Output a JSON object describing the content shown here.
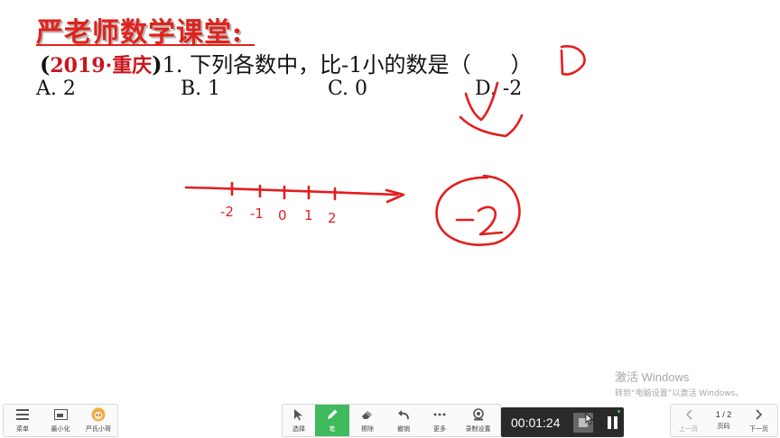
{
  "title": "严老师数学课堂:",
  "question": {
    "paren_open": "(",
    "source": "2019·重庆",
    "paren_close": ")",
    "text": "1. 下列各数中，比-1小的数是（",
    "answer_close": "）"
  },
  "options": [
    "A. 2",
    "B. 1",
    "C. 0",
    "D. -2"
  ],
  "handwriting": {
    "answer_letter": "D",
    "number_line_labels": [
      "-2",
      "-1",
      "0",
      "1",
      "2"
    ],
    "circled_number": "-2"
  },
  "watermark": {
    "title": "激活 Windows",
    "subtitle": "转到“电脑设置”以激活 Windows。"
  },
  "toolbar": {
    "left": [
      {
        "label": "菜单",
        "icon": "menu-icon"
      },
      {
        "label": "最小化",
        "icon": "minimize-icon"
      },
      {
        "label": "严氏小哥",
        "icon": "avatar-icon"
      }
    ],
    "center": [
      {
        "label": "选择",
        "icon": "cursor-icon"
      },
      {
        "label": "笔",
        "icon": "pen-icon",
        "active": true
      },
      {
        "label": "擦除",
        "icon": "eraser-icon"
      },
      {
        "label": "撤销",
        "icon": "undo-icon"
      },
      {
        "label": "更多",
        "icon": "more-icon"
      },
      {
        "label": "录制设置",
        "icon": "camera-settings-icon"
      }
    ],
    "recorder": {
      "time": "00:01:24"
    },
    "pagination": {
      "prev": "上一页",
      "page": "1 / 2",
      "page_label": "页码",
      "next": "下一页"
    }
  },
  "colors": {
    "ink": "#e31e1e",
    "title": "#e0221b",
    "active_tool": "#3fba5c",
    "recorder_bg": "#2a2a2a"
  }
}
